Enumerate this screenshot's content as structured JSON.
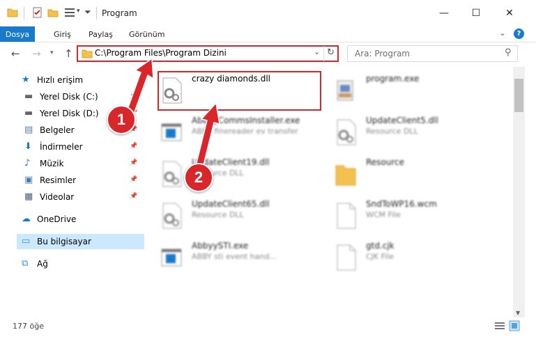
{
  "window": {
    "title": "Program",
    "minimize": "—",
    "maximize": "☐",
    "close": "✕"
  },
  "ribbon": {
    "tabs": [
      "Dosya",
      "Giriş",
      "Paylaş",
      "Görünüm"
    ],
    "help": "?",
    "expand": "⌄"
  },
  "address": {
    "path": "C:\\Program Files\\Program Dizini"
  },
  "search": {
    "placeholder": "Ara: Program"
  },
  "nav": {
    "items": [
      {
        "label": "Hızlı erişim",
        "icon": "star-icon",
        "pinned": false
      },
      {
        "label": "Yerel Disk (C:)",
        "icon": "drive-icon",
        "pinned": true
      },
      {
        "label": "Yerel Disk (D:)",
        "icon": "drive-icon",
        "pinned": true
      },
      {
        "label": "Belgeler",
        "icon": "documents-icon",
        "pinned": true
      },
      {
        "label": "İndirmeler",
        "icon": "download-icon",
        "pinned": true
      },
      {
        "label": "Müzik",
        "icon": "music-icon",
        "pinned": true
      },
      {
        "label": "Resimler",
        "icon": "pictures-icon",
        "pinned": true
      },
      {
        "label": "Videolar",
        "icon": "videos-icon",
        "pinned": true
      },
      {
        "label": "OneDrive",
        "icon": "cloud-icon",
        "pinned": false
      },
      {
        "label": "Bu bilgisayar",
        "icon": "computer-icon",
        "pinned": false
      },
      {
        "label": "Ağ",
        "icon": "network-icon",
        "pinned": false
      }
    ]
  },
  "files": [
    {
      "name": "crazy diamonds.dll",
      "desc": "",
      "icon": "dll-gear-icon"
    },
    {
      "name": "program.exe",
      "desc": "",
      "icon": "exe-icon"
    },
    {
      "name": "AbbyyCommsInstaller.exe",
      "desc": "ABBY finereader ev transfer",
      "icon": "exe-window-icon"
    },
    {
      "name": "UpdateClient5.dll",
      "desc": "Resource DLL",
      "icon": "dll-gear-icon"
    },
    {
      "name": "UpdateClient19.dll",
      "desc": "Resource DLL",
      "icon": "dll-gear-icon"
    },
    {
      "name": "Resource",
      "desc": "",
      "icon": "folder-icon"
    },
    {
      "name": "UpdateClient65.dll",
      "desc": "Resource DLL",
      "icon": "dll-gear-icon"
    },
    {
      "name": "SndToWP16.wcm",
      "desc": "WCM File",
      "icon": "file-icon"
    },
    {
      "name": "AbbyySTI.exe",
      "desc": "ABBY sti event hand...",
      "icon": "exe-window-icon"
    },
    {
      "name": "gtd.cjk",
      "desc": "CJK File",
      "icon": "file-icon"
    }
  ],
  "status": {
    "count": "177 öğe"
  },
  "annotations": [
    "1",
    "2"
  ],
  "colors": {
    "accent": "#1979ca",
    "highlight": "#d9262b",
    "selected_nav": "#cce8ff"
  }
}
